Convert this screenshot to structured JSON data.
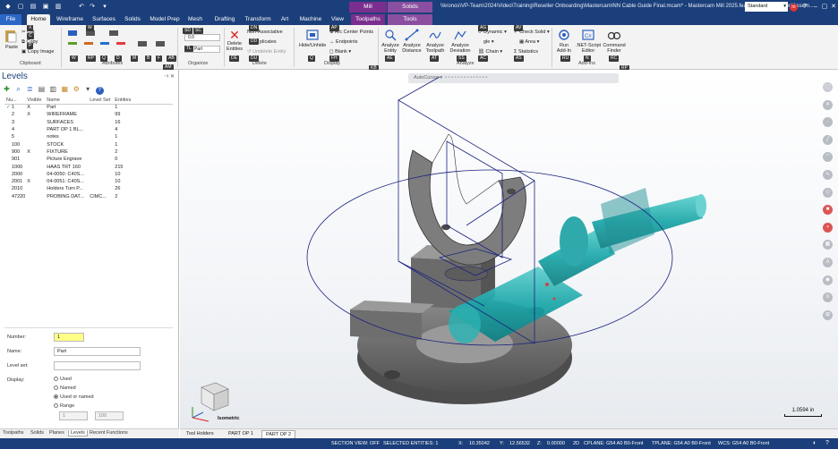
{
  "titlebar": {
    "title": "\\\\kronos\\VP-Team\\2024\\Video\\Training\\Reseller Onboarding\\Mastercam\\NN Cable Guide Final.mcam* - Mastercam Mill 2025.feature/Team5/MillToolAssem...",
    "context_tabs": [
      "Mill",
      "Solids Selection"
    ],
    "context_sub_tabs": [
      "Toolpaths",
      "Tools"
    ],
    "workspace": "Standard"
  },
  "tabs": [
    "File",
    "Home",
    "Wireframe",
    "Surfaces",
    "Solids",
    "Model Prep",
    "Mesh",
    "Drafting",
    "Transform",
    "Art",
    "Machine",
    "View"
  ],
  "ribbon": {
    "clipboard": {
      "paste": "Paste",
      "cut": "Cut",
      "copy": "Copy",
      "copy_image": "Copy Image",
      "label": "Clipboard"
    },
    "attributes": {
      "label": "Attributes"
    },
    "organize": {
      "level_value": "1 : Part",
      "label": "Organize"
    },
    "delete": {
      "delete_entities": "Delete Entities",
      "non_associative": "Non-Associative",
      "duplicates": "plicates",
      "undelete": "Undelete Entity",
      "label": "Delete"
    },
    "display": {
      "hide_unhide": "Hide/Unhide",
      "arc_center_points": "Arc Center Points",
      "endpoints": "Endpoints",
      "blank": "Blank",
      "label": "Display"
    },
    "analyze": {
      "analyze_entity": "Analyze Entity",
      "analyze_distance": "Analyze Distance",
      "analyze_toolpath": "Analyze Toolpath",
      "analyze_deviation": "Analyze Deviation",
      "dynamic": "Dynamic",
      "angle": "gle",
      "chain": "Chain",
      "check_solid": "Check Solid",
      "area": "Area",
      "statistics": "Statistics",
      "label": "Analyze"
    },
    "addins": {
      "run_addin": "Run Add-In",
      "net_script": ".NET-Script Editor",
      "label": "Add-Ins"
    },
    "finder": {
      "command_finder": "Command Finder"
    }
  },
  "keytips": [
    "X",
    "C",
    "H",
    "P",
    "W",
    "S",
    "O",
    "Q",
    "M",
    "B",
    "F",
    "AB",
    "AM",
    "SD",
    "SC",
    "TL",
    "LN",
    "DE",
    "DN",
    "DD",
    "DU",
    "AP",
    "AS",
    "EP",
    "FH",
    "KB",
    "AG",
    "AV",
    "AR",
    "AU",
    "AI",
    "SS",
    "AE",
    "AT",
    "AC",
    "RU",
    "N",
    "RC",
    "RP",
    "V",
    "Y",
    "G",
    "I",
    "T",
    "D"
  ],
  "levels_panel": {
    "title": "Levels",
    "columns": [
      "Nu...",
      "Visible",
      "Name",
      "Level Set",
      "Entities"
    ],
    "rows": [
      {
        "num": "1",
        "check": "✓",
        "visible": "X",
        "name": "Part",
        "set": "",
        "entities": "1"
      },
      {
        "num": "2",
        "check": "",
        "visible": "X",
        "name": "WIREFRAME",
        "set": "",
        "entities": "99"
      },
      {
        "num": "3",
        "check": "",
        "visible": "",
        "name": "SURFACES",
        "set": "",
        "entities": "16"
      },
      {
        "num": "4",
        "check": "",
        "visible": "",
        "name": "PART OP 1 BL...",
        "set": "",
        "entities": "4"
      },
      {
        "num": "5",
        "check": "",
        "visible": "",
        "name": "notes",
        "set": "",
        "entities": "1"
      },
      {
        "num": "100",
        "check": "",
        "visible": "",
        "name": "STOCK",
        "set": "",
        "entities": "1"
      },
      {
        "num": "900",
        "check": "",
        "visible": "X",
        "name": "FIXTURE",
        "set": "",
        "entities": "2"
      },
      {
        "num": "901",
        "check": "",
        "visible": "",
        "name": "Picture Engrave",
        "set": "",
        "entities": "0"
      },
      {
        "num": "1000",
        "check": "",
        "visible": "",
        "name": "HAAS TRT 160",
        "set": "",
        "entities": "215"
      },
      {
        "num": "2000",
        "check": "",
        "visible": "",
        "name": "04-0050: C40S...",
        "set": "",
        "entities": "10"
      },
      {
        "num": "2001",
        "check": "",
        "visible": "X",
        "name": "04-0051: C40S...",
        "set": "",
        "entities": "10"
      },
      {
        "num": "2010",
        "check": "",
        "visible": "",
        "name": "Holders Turn P...",
        "set": "",
        "entities": "26"
      },
      {
        "num": "47220",
        "check": "",
        "visible": "",
        "name": "PROBING DAT...",
        "set": "CIMC...",
        "entities": "2"
      }
    ],
    "form": {
      "number_label": "Number:",
      "number_value": "1",
      "name_label": "Name:",
      "name_value": "Part",
      "level_set_label": "Level set:",
      "level_set_value": "",
      "display_label": "Display:",
      "options": [
        "Used",
        "Named",
        "Used or named",
        "Range"
      ],
      "range_from": "1",
      "range_to": "100"
    }
  },
  "bottom_tabs": [
    "Toolpaths",
    "Solids",
    "Planes",
    "Levels",
    "Recent Functions"
  ],
  "viewport": {
    "toolbar_text": "AutoCursor",
    "view_label": "Isometric",
    "scale": "1.0594 in",
    "part_tabs": [
      "Tool Holders",
      "PART OP 1",
      "PART OP 2"
    ]
  },
  "statusbar": {
    "section_view": "SECTION VIEW: OFF",
    "selected": "SELECTED ENTITIES: 1",
    "x_label": "X:",
    "x": "10.35042",
    "y_label": "Y:",
    "y": "12.56532",
    "z_label": "Z:",
    "z": "0.00000",
    "mode": "2D",
    "cplane": "CPLANE: G54 A0 B0-Front",
    "tplane": "TPLANE: G54 A0 B0-Front",
    "wcs": "WCS: G54 A0 B0-Front"
  },
  "colors": {
    "accent": "#1b3f7a",
    "teal_tool": "#1aa6a8",
    "part_gray": "#6b6b6b",
    "wire_blue": "#1a237e"
  }
}
